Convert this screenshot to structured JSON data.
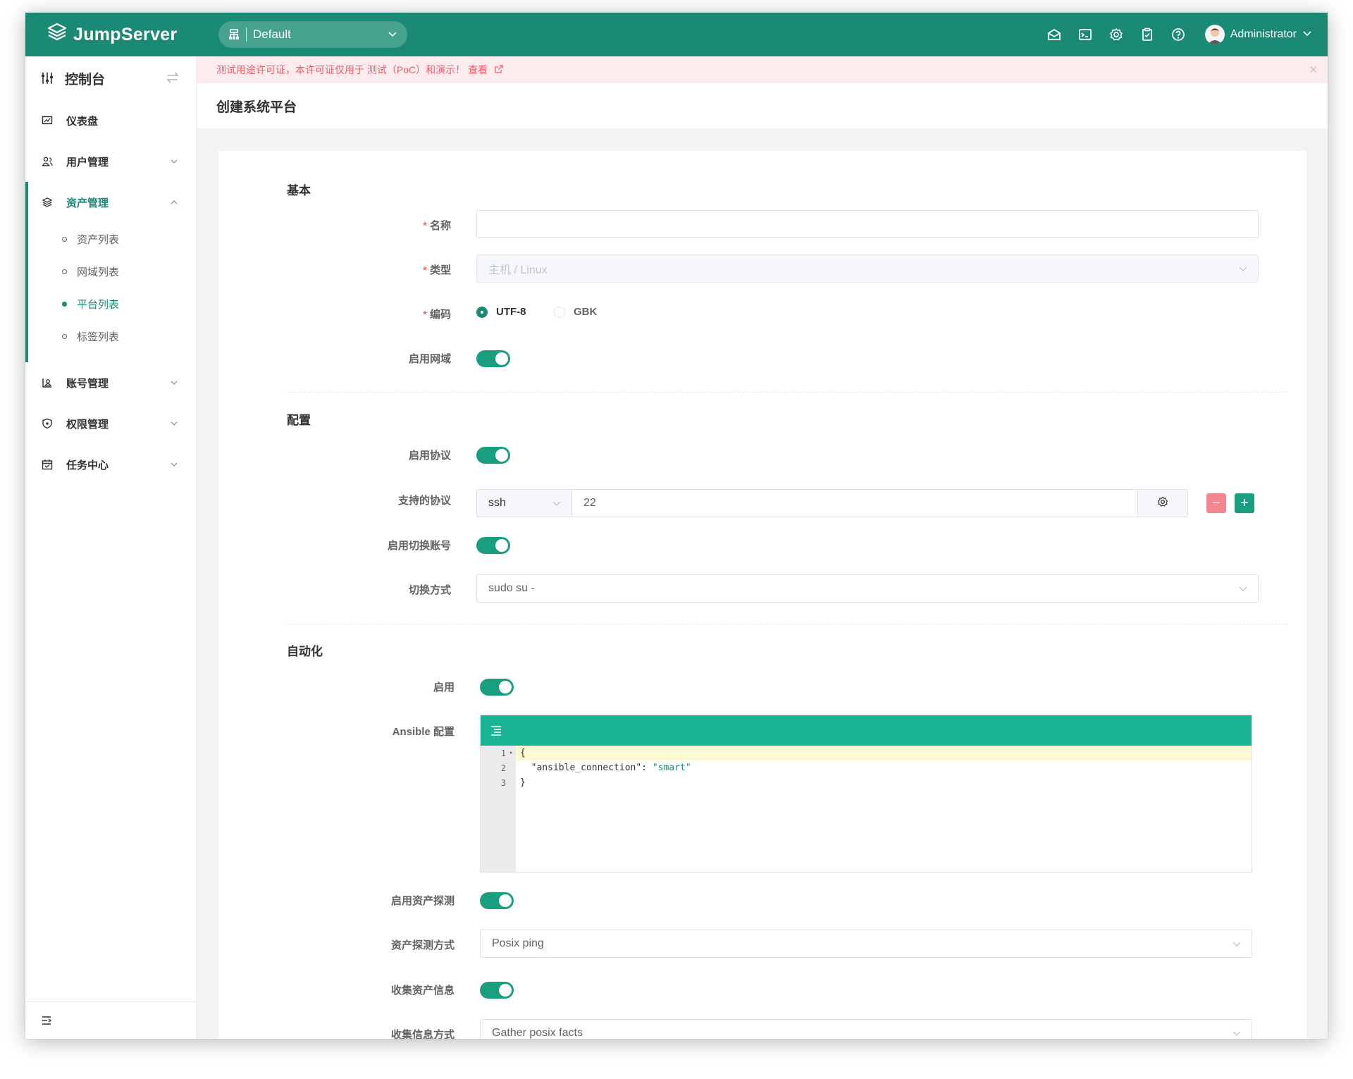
{
  "app": {
    "logo_text": "JumpServer",
    "org": "Default",
    "user": "Administrator"
  },
  "topbar_icons": [
    "mail-icon",
    "terminal-icon",
    "settings-icon",
    "clipboard-icon",
    "help-icon"
  ],
  "sidebar": {
    "title": "控制台",
    "items": [
      {
        "label": "仪表盘",
        "icon": "dashboard-icon"
      },
      {
        "label": "用户管理",
        "icon": "users-icon"
      },
      {
        "label": "资产管理",
        "icon": "layers-icon"
      },
      {
        "label": "账号管理",
        "icon": "account-icon"
      },
      {
        "label": "权限管理",
        "icon": "shield-icon"
      },
      {
        "label": "任务中心",
        "icon": "calendar-icon"
      }
    ],
    "asset_sub": [
      {
        "label": "资产列表"
      },
      {
        "label": "网域列表"
      },
      {
        "label": "平台列表"
      },
      {
        "label": "标签列表"
      }
    ]
  },
  "alert": {
    "text": "测试用途许可证，本许可证仅用于 测试（PoC）和演示！ 查看"
  },
  "page": {
    "title": "创建系统平台"
  },
  "form": {
    "basic": {
      "section": "基本",
      "name_label": "名称",
      "name_value": "",
      "type_label": "类型",
      "type_value": "主机 / Linux",
      "encoding_label": "编码",
      "encoding_options": [
        "UTF-8",
        "GBK"
      ],
      "encoding_selected": "UTF-8",
      "gateway_label": "启用网域",
      "gateway_enabled": true
    },
    "config": {
      "section": "配置",
      "protocol_enabled_label": "启用协议",
      "protocol_enabled": true,
      "protocols_label": "支持的协议",
      "protocol_name": "ssh",
      "protocol_port": "22",
      "su_enabled_label": "启用切换账号",
      "su_enabled": true,
      "su_method_label": "切换方式",
      "su_method_value": "sudo su -"
    },
    "automation": {
      "section": "自动化",
      "enable_label": "启用",
      "enabled": true,
      "ansible_label": "Ansible 配置",
      "ansible_lines": [
        "{",
        "  \"ansible_connection\": \"smart\"",
        "}"
      ],
      "ansible_key": "\"ansible_connection\"",
      "ansible_colon": ": ",
      "ansible_val": "\"smart\"",
      "ping_enabled_label": "启用资产探测",
      "ping_enabled": true,
      "ping_method_label": "资产探测方式",
      "ping_method_value": "Posix ping",
      "gather_enabled_label": "收集资产信息",
      "gather_enabled": true,
      "gather_method_label": "收集信息方式",
      "gather_method_value": "Gather posix facts"
    }
  },
  "colors": {
    "brand": "#1a8a74",
    "editor_bar": "#1ab394",
    "danger": "#f25a66"
  }
}
